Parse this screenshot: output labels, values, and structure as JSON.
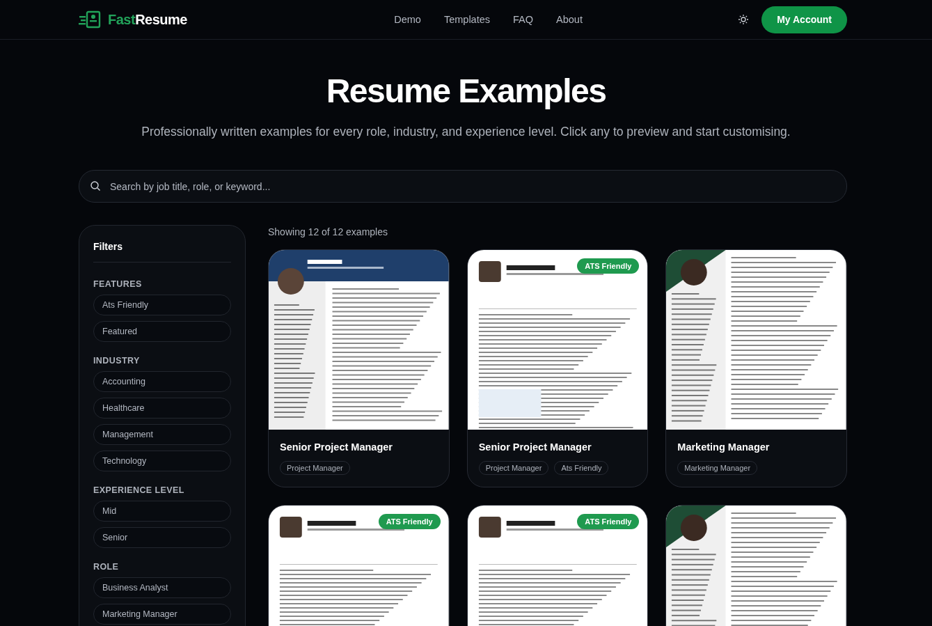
{
  "header": {
    "logo": {
      "part_1": "Fast",
      "part_2": "Resume"
    },
    "nav": [
      "Demo",
      "Templates",
      "FAQ",
      "About"
    ],
    "account_button": "My Account"
  },
  "hero": {
    "title": "Resume Examples",
    "subtitle": "Professionally written examples for every role, industry, and experience level. Click any to preview and start customising."
  },
  "search": {
    "placeholder": "Search by job title, role, or keyword..."
  },
  "filters": {
    "title": "Filters",
    "groups": [
      {
        "heading": "FEATURES",
        "options": [
          "Ats Friendly",
          "Featured"
        ]
      },
      {
        "heading": "INDUSTRY",
        "options": [
          "Accounting",
          "Healthcare",
          "Management",
          "Technology"
        ]
      },
      {
        "heading": "EXPERIENCE LEVEL",
        "options": [
          "Mid",
          "Senior"
        ]
      },
      {
        "heading": "ROLE",
        "options": [
          "Business Analyst",
          "Marketing Manager"
        ]
      }
    ]
  },
  "results": {
    "count": "Showing 12 of 12 examples",
    "cards": [
      {
        "preview": {
          "kind": "picture"
        },
        "title": "Senior Project Manager",
        "tags": [
          "Project Manager"
        ]
      },
      {
        "preview": {
          "kind": "picture"
        },
        "badge": "ATS Friendly",
        "title": "Senior Project Manager",
        "tags": [
          "Project Manager",
          "Ats Friendly"
        ]
      },
      {
        "preview": {
          "kind": "picture"
        },
        "title": "Marketing Manager",
        "tags": [
          "Marketing Manager"
        ]
      },
      {
        "preview": {
          "kind": "picture"
        },
        "badge": "ATS Friendly"
      },
      {
        "preview": {
          "kind": "picture"
        },
        "badge": "ATS Friendly"
      },
      {
        "preview": {
          "kind": "picture"
        }
      }
    ]
  }
}
